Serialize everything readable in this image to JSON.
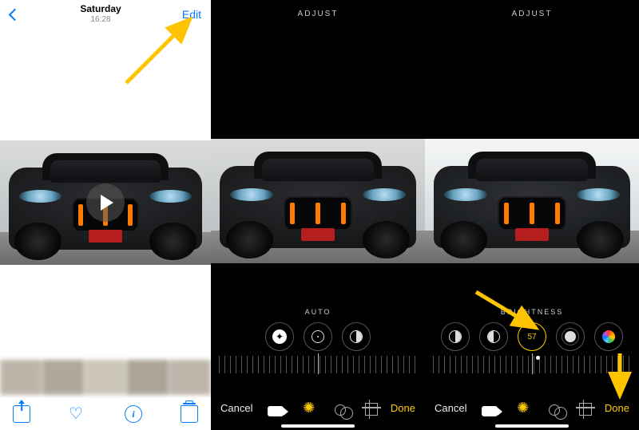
{
  "panel1": {
    "header": {
      "back": "Back",
      "day": "Saturday",
      "time": "16:28",
      "edit": "Edit"
    },
    "toolbar": {
      "share": "Share",
      "favorite": "Favorite",
      "info": "Info",
      "delete": "Delete"
    }
  },
  "panel2": {
    "header": "ADJUST",
    "label": "AUTO",
    "dials": [
      "auto-wand",
      "exposure",
      "contrast"
    ],
    "footer": {
      "cancel": "Cancel",
      "done": "Done"
    }
  },
  "panel3": {
    "header": "ADJUST",
    "label": "BRIGHTNESS",
    "value": "57",
    "dials": [
      "contrast",
      "half-fill",
      "value",
      "solid-dot",
      "rainbow"
    ],
    "footer": {
      "cancel": "Cancel",
      "done": "Done"
    }
  }
}
